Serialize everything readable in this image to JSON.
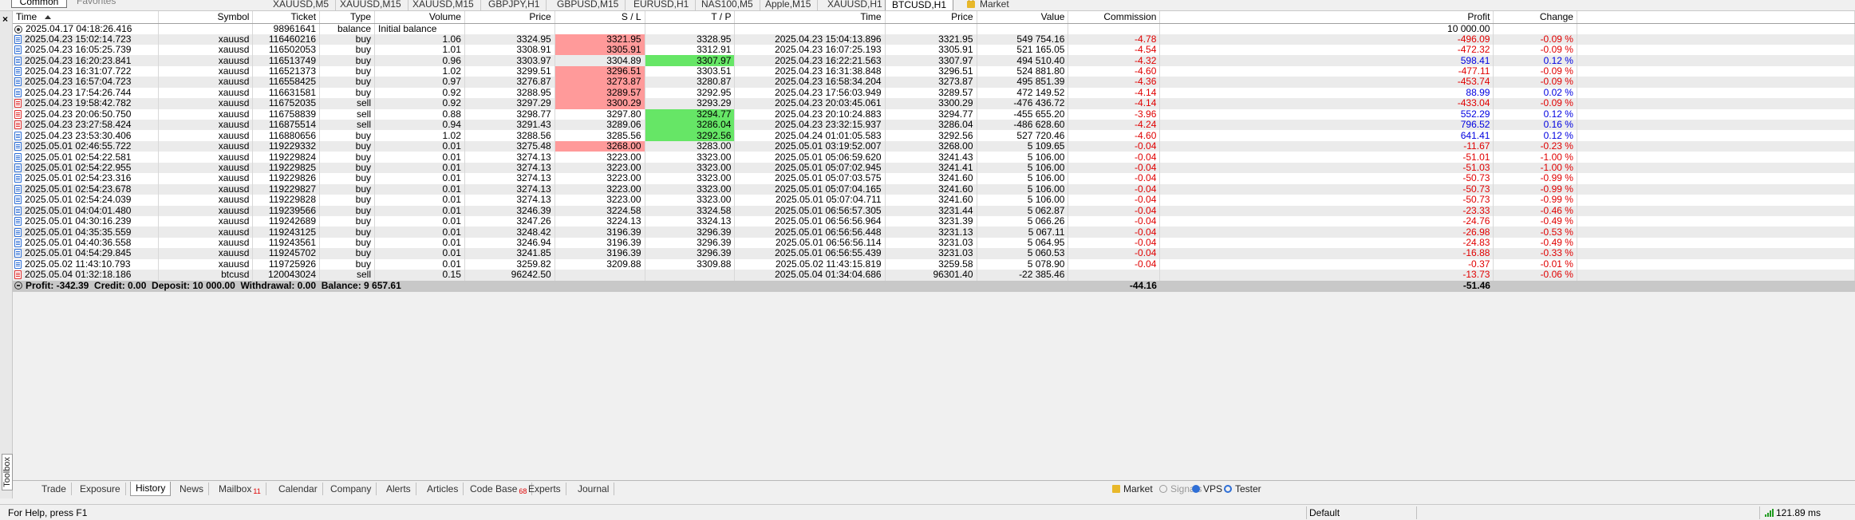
{
  "top": {
    "common_label": "Common",
    "favorites_label": "Favorites",
    "chart_tabs": [
      "XAUUSD,M5",
      "XAUUSD,M15",
      "XAUUSD,M15",
      "GBPJPY,H1",
      "GBPUSD,M15",
      "EURUSD,H1",
      "NAS100,M5",
      "Apple,M15",
      "XAUUSD,H1",
      "BTCUSD,H1"
    ],
    "active_chart_tab": "BTCUSD,H1",
    "market_tab": "Market"
  },
  "columns": [
    "Time",
    "Symbol",
    "Ticket",
    "Type",
    "Volume",
    "Price",
    "S / L",
    "T / P",
    "Time",
    "Price",
    "Value",
    "Commission",
    "Profit",
    "Change"
  ],
  "rows": [
    {
      "time": "2025.04.17 04:18:26.416",
      "symbol": "",
      "ticket": "98961641",
      "type": "balance",
      "volume": "Initial balance",
      "price": "",
      "sl": "",
      "tp": "",
      "close_time": "",
      "close_price": "",
      "value": "",
      "commission": "",
      "profit": "10 000.00",
      "change": ""
    },
    {
      "time": "2025.04.23 15:02:14.723",
      "symbol": "xauusd",
      "ticket": "116460216",
      "type": "buy",
      "volume": "1.06",
      "price": "3324.95",
      "sl": "3321.95",
      "tp": "3328.95",
      "close_time": "2025.04.23 15:04:13.896",
      "close_price": "3321.95",
      "value": "549 754.16",
      "commission": "-4.78",
      "profit": "-496.09",
      "change": "-0.09 %"
    },
    {
      "time": "2025.04.23 16:05:25.739",
      "symbol": "xauusd",
      "ticket": "116502053",
      "type": "buy",
      "volume": "1.01",
      "price": "3308.91",
      "sl": "3305.91",
      "tp": "3312.91",
      "close_time": "2025.04.23 16:07:25.193",
      "close_price": "3305.91",
      "value": "521 165.05",
      "commission": "-4.54",
      "profit": "-472.32",
      "change": "-0.09 %"
    },
    {
      "time": "2025.04.23 16:20:23.841",
      "symbol": "xauusd",
      "ticket": "116513749",
      "type": "buy",
      "volume": "0.96",
      "price": "3303.97",
      "sl": "3304.89",
      "tp": "3307.97",
      "close_time": "2025.04.23 16:22:21.563",
      "close_price": "3307.97",
      "value": "494 510.40",
      "commission": "-4.32",
      "profit": "598.41",
      "change": "0.12 %"
    },
    {
      "time": "2025.04.23 16:31:07.722",
      "symbol": "xauusd",
      "ticket": "116521373",
      "type": "buy",
      "volume": "1.02",
      "price": "3299.51",
      "sl": "3296.51",
      "tp": "3303.51",
      "close_time": "2025.04.23 16:31:38.848",
      "close_price": "3296.51",
      "value": "524 881.80",
      "commission": "-4.60",
      "profit": "-477.11",
      "change": "-0.09 %"
    },
    {
      "time": "2025.04.23 16:57:04.723",
      "symbol": "xauusd",
      "ticket": "116558425",
      "type": "buy",
      "volume": "0.97",
      "price": "3276.87",
      "sl": "3273.87",
      "tp": "3280.87",
      "close_time": "2025.04.23 16:58:34.204",
      "close_price": "3273.87",
      "value": "495 851.39",
      "commission": "-4.36",
      "profit": "-453.74",
      "change": "-0.09 %"
    },
    {
      "time": "2025.04.23 17:54:26.744",
      "symbol": "xauusd",
      "ticket": "116631581",
      "type": "buy",
      "volume": "0.92",
      "price": "3288.95",
      "sl": "3289.57",
      "tp": "3292.95",
      "close_time": "2025.04.23 17:56:03.949",
      "close_price": "3289.57",
      "value": "472 149.52",
      "commission": "-4.14",
      "profit": "88.99",
      "change": "0.02 %"
    },
    {
      "time": "2025.04.23 19:58:42.782",
      "symbol": "xauusd",
      "ticket": "116752035",
      "type": "sell",
      "volume": "0.92",
      "price": "3297.29",
      "sl": "3300.29",
      "tp": "3293.29",
      "close_time": "2025.04.23 20:03:45.061",
      "close_price": "3300.29",
      "value": "-476 436.72",
      "commission": "-4.14",
      "profit": "-433.04",
      "change": "-0.09 %"
    },
    {
      "time": "2025.04.23 20:06:50.750",
      "symbol": "xauusd",
      "ticket": "116758839",
      "type": "sell",
      "volume": "0.88",
      "price": "3298.77",
      "sl": "3297.80",
      "tp": "3294.77",
      "close_time": "2025.04.23 20:10:24.883",
      "close_price": "3294.77",
      "value": "-455 655.20",
      "commission": "-3.96",
      "profit": "552.29",
      "change": "0.12 %"
    },
    {
      "time": "2025.04.23 23:27:58.424",
      "symbol": "xauusd",
      "ticket": "116875514",
      "type": "sell",
      "volume": "0.94",
      "price": "3291.43",
      "sl": "3289.06",
      "tp": "3286.04",
      "close_time": "2025.04.23 23:32:15.937",
      "close_price": "3286.04",
      "value": "-486 628.60",
      "commission": "-4.24",
      "profit": "796.52",
      "change": "0.16 %"
    },
    {
      "time": "2025.04.23 23:53:30.406",
      "symbol": "xauusd",
      "ticket": "116880656",
      "type": "buy",
      "volume": "1.02",
      "price": "3288.56",
      "sl": "3285.56",
      "tp": "3292.56",
      "close_time": "2025.04.24 01:01:05.583",
      "close_price": "3292.56",
      "value": "527 720.46",
      "commission": "-4.60",
      "profit": "641.41",
      "change": "0.12 %"
    },
    {
      "time": "2025.05.01 02:46:55.722",
      "symbol": "xauusd",
      "ticket": "119229332",
      "type": "buy",
      "volume": "0.01",
      "price": "3275.48",
      "sl": "3268.00",
      "tp": "3283.00",
      "close_time": "2025.05.01 03:19:52.007",
      "close_price": "3268.00",
      "value": "5 109.65",
      "commission": "-0.04",
      "profit": "-11.67",
      "change": "-0.23 %"
    },
    {
      "time": "2025.05.01 02:54:22.581",
      "symbol": "xauusd",
      "ticket": "119229824",
      "type": "buy",
      "volume": "0.01",
      "price": "3274.13",
      "sl": "3223.00",
      "tp": "3323.00",
      "close_time": "2025.05.01 05:06:59.620",
      "close_price": "3241.43",
      "value": "5 106.00",
      "commission": "-0.04",
      "profit": "-51.01",
      "change": "-1.00 %"
    },
    {
      "time": "2025.05.01 02:54:22.955",
      "symbol": "xauusd",
      "ticket": "119229825",
      "type": "buy",
      "volume": "0.01",
      "price": "3274.13",
      "sl": "3223.00",
      "tp": "3323.00",
      "close_time": "2025.05.01 05:07:02.945",
      "close_price": "3241.41",
      "value": "5 106.00",
      "commission": "-0.04",
      "profit": "-51.03",
      "change": "-1.00 %"
    },
    {
      "time": "2025.05.01 02:54:23.316",
      "symbol": "xauusd",
      "ticket": "119229826",
      "type": "buy",
      "volume": "0.01",
      "price": "3274.13",
      "sl": "3223.00",
      "tp": "3323.00",
      "close_time": "2025.05.01 05:07:03.575",
      "close_price": "3241.60",
      "value": "5 106.00",
      "commission": "-0.04",
      "profit": "-50.73",
      "change": "-0.99 %"
    },
    {
      "time": "2025.05.01 02:54:23.678",
      "symbol": "xauusd",
      "ticket": "119229827",
      "type": "buy",
      "volume": "0.01",
      "price": "3274.13",
      "sl": "3223.00",
      "tp": "3323.00",
      "close_time": "2025.05.01 05:07:04.165",
      "close_price": "3241.60",
      "value": "5 106.00",
      "commission": "-0.04",
      "profit": "-50.73",
      "change": "-0.99 %"
    },
    {
      "time": "2025.05.01 02:54:24.039",
      "symbol": "xauusd",
      "ticket": "119229828",
      "type": "buy",
      "volume": "0.01",
      "price": "3274.13",
      "sl": "3223.00",
      "tp": "3323.00",
      "close_time": "2025.05.01 05:07:04.711",
      "close_price": "3241.60",
      "value": "5 106.00",
      "commission": "-0.04",
      "profit": "-50.73",
      "change": "-0.99 %"
    },
    {
      "time": "2025.05.01 04:04:01.480",
      "symbol": "xauusd",
      "ticket": "119239566",
      "type": "buy",
      "volume": "0.01",
      "price": "3246.39",
      "sl": "3224.58",
      "tp": "3324.58",
      "close_time": "2025.05.01 06:56:57.305",
      "close_price": "3231.44",
      "value": "5 062.87",
      "commission": "-0.04",
      "profit": "-23.33",
      "change": "-0.46 %"
    },
    {
      "time": "2025.05.01 04:30:16.239",
      "symbol": "xauusd",
      "ticket": "119242689",
      "type": "buy",
      "volume": "0.01",
      "price": "3247.26",
      "sl": "3224.13",
      "tp": "3324.13",
      "close_time": "2025.05.01 06:56:56.964",
      "close_price": "3231.39",
      "value": "5 066.26",
      "commission": "-0.04",
      "profit": "-24.76",
      "change": "-0.49 %"
    },
    {
      "time": "2025.05.01 04:35:35.559",
      "symbol": "xauusd",
      "ticket": "119243125",
      "type": "buy",
      "volume": "0.01",
      "price": "3248.42",
      "sl": "3196.39",
      "tp": "3296.39",
      "close_time": "2025.05.01 06:56:56.448",
      "close_price": "3231.13",
      "value": "5 067.11",
      "commission": "-0.04",
      "profit": "-26.98",
      "change": "-0.53 %"
    },
    {
      "time": "2025.05.01 04:40:36.558",
      "symbol": "xauusd",
      "ticket": "119243561",
      "type": "buy",
      "volume": "0.01",
      "price": "3246.94",
      "sl": "3196.39",
      "tp": "3296.39",
      "close_time": "2025.05.01 06:56:56.114",
      "close_price": "3231.03",
      "value": "5 064.95",
      "commission": "-0.04",
      "profit": "-24.83",
      "change": "-0.49 %"
    },
    {
      "time": "2025.05.01 04:54:29.845",
      "symbol": "xauusd",
      "ticket": "119245702",
      "type": "buy",
      "volume": "0.01",
      "price": "3241.85",
      "sl": "3196.39",
      "tp": "3296.39",
      "close_time": "2025.05.01 06:56:55.439",
      "close_price": "3231.03",
      "value": "5 060.53",
      "commission": "-0.04",
      "profit": "-16.88",
      "change": "-0.33 %"
    },
    {
      "time": "2025.05.02 11:43:10.793",
      "symbol": "xauusd",
      "ticket": "119725926",
      "type": "buy",
      "volume": "0.01",
      "price": "3259.82",
      "sl": "3209.88",
      "tp": "3309.88",
      "close_time": "2025.05.02 11:43:15.819",
      "close_price": "3259.58",
      "value": "5 078.90",
      "commission": "-0.04",
      "profit": "-0.37",
      "change": "-0.01 %"
    },
    {
      "time": "2025.05.04 01:32:18.186",
      "symbol": "btcusd",
      "ticket": "120043024",
      "type": "sell",
      "volume": "0.15",
      "price": "96242.50",
      "sl": "",
      "tp": "",
      "close_time": "2025.05.04 01:34:04.686",
      "close_price": "96301.40",
      "value": "-22 385.46",
      "commission": "",
      "profit": "-13.73",
      "change": "-0.06 %"
    }
  ],
  "summary": {
    "text": "Profit: -342.39  Credit: 0.00  Deposit: 10 000.00  Withdrawal: 0.00  Balance: 9 657.61",
    "commission_total": "-44.16",
    "profit_total": "-51.46"
  },
  "left": {
    "close": "×",
    "toolbox": "Toolbox"
  },
  "bottom_tabs": [
    {
      "label": "Trade",
      "badge": ""
    },
    {
      "label": "Exposure",
      "badge": ""
    },
    {
      "label": "History",
      "badge": ""
    },
    {
      "label": "News",
      "badge": ""
    },
    {
      "label": "Mailbox",
      "badge": "11"
    },
    {
      "label": "Calendar",
      "badge": ""
    },
    {
      "label": "Company",
      "badge": ""
    },
    {
      "label": "Alerts",
      "badge": ""
    },
    {
      "label": "Articles",
      "badge": ""
    },
    {
      "label": "Code Base",
      "badge": "68"
    },
    {
      "label": "Experts",
      "badge": ""
    },
    {
      "label": "Journal",
      "badge": ""
    }
  ],
  "active_bottom_tab": "History",
  "right_tabs": {
    "market": "Market",
    "signals": "Signals",
    "vps": "VPS",
    "tester": "Tester"
  },
  "status": {
    "help": "For Help, press F1",
    "profile": "Default",
    "ping": "121.89 ms"
  },
  "colors": {
    "loss": "#e00000",
    "gain": "#0000e0",
    "sl_hit": "#ff9a9a",
    "tp_hit": "#66e666"
  }
}
